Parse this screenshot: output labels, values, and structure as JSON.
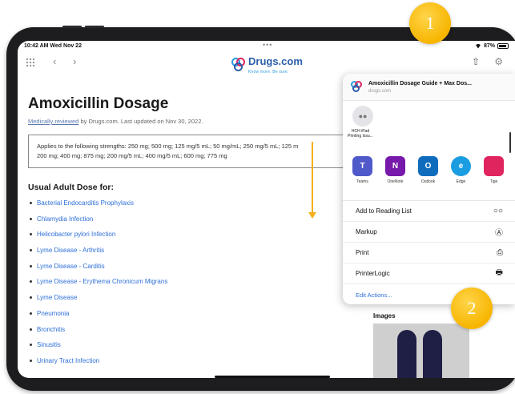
{
  "status_bar": {
    "time": "10:42 AM  Wed Nov 22",
    "dots": "•••",
    "battery": "87%"
  },
  "toolbar": {
    "logo_text": "Drugs.com",
    "logo_tagline": "Know more. Be sure."
  },
  "article": {
    "title": "Amoxicillin Dosage",
    "reviewed_link": "Medically reviewed",
    "reviewed_rest": " by Drugs.com. Last updated on Nov 30, 2022.",
    "strengths_line1": "Applies to the following strengths: 250 mg; 500 mg; 125 mg/5 mL; 50 mg/mL; 250 mg/5 mL; 125 m",
    "strengths_line2": "200 mg; 400 mg; 875 mg; 200 mg/5 mL; 400 mg/5 mL; 600 mg; 775 mg",
    "section_heading": "Usual Adult Dose for:",
    "dose_items": [
      "Bacterial Endocarditis Prophylaxis",
      "Chlamydia Infection",
      "Helicobacter pylori Infection",
      "Lyme Disease - Arthritis",
      "Lyme Disease - Carditis",
      "Lyme Disease - Erythema Chronicum Migrans",
      "Lyme Disease",
      "Pneumonia",
      "Bronchitis",
      "Sinusitis",
      "Urinary Tract Infection"
    ]
  },
  "share_sheet": {
    "title": "Amoxicillin Dosage Guide + Max Dos...",
    "url": "drugs.com",
    "airdrop_name_line1": "HCH iPad",
    "airdrop_name_line2": "Printing Issu...",
    "apps": [
      {
        "name": "Teams",
        "glyph": "T",
        "color": "#5059c9"
      },
      {
        "name": "OneNote",
        "glyph": "N",
        "color": "#7719aa"
      },
      {
        "name": "Outlook",
        "glyph": "O",
        "color": "#0f6cbd"
      },
      {
        "name": "Edge",
        "glyph": "e",
        "color": "#1b9de2"
      },
      {
        "name": "Tige",
        "glyph": "",
        "color": "#e0245e"
      }
    ],
    "actions": [
      {
        "label": "Add to Reading List",
        "icon": "glasses-icon",
        "glyph": "○○"
      },
      {
        "label": "Markup",
        "icon": "markup-icon",
        "glyph": "Ⓐ"
      },
      {
        "label": "Print",
        "icon": "printer-icon",
        "glyph": "⎙"
      },
      {
        "label": "PrinterLogic",
        "icon": "printerlogic-icon",
        "glyph": "🖶"
      }
    ],
    "edit_actions": "Edit Actions..."
  },
  "sidebar_right": {
    "images_label": "Images"
  },
  "callouts": {
    "one": "1",
    "two": "2"
  },
  "colors": {
    "link": "#2e6fd8",
    "badge": "#f7b500",
    "arrow": "#f5b01a"
  }
}
